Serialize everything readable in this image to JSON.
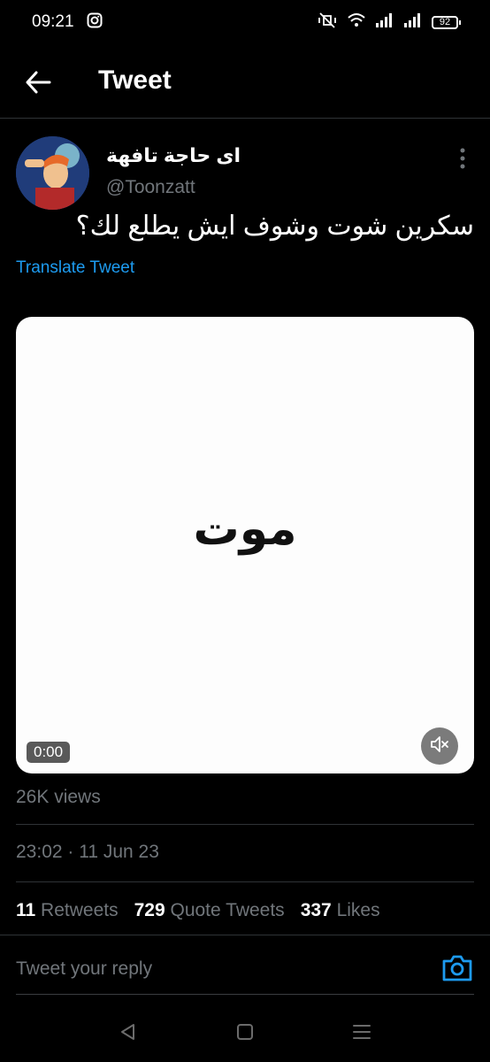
{
  "status_bar": {
    "time": "09:21",
    "battery": "92",
    "icons": [
      "instagram-icon",
      "mute-vibrate-icon",
      "wifi-icon",
      "signal-icon",
      "signal-icon",
      "battery-icon"
    ]
  },
  "header": {
    "title": "Tweet",
    "back_icon": "arrow-left-icon"
  },
  "tweet": {
    "author_name": "اى حاجة تافهة",
    "author_handle": "@Toonzatt",
    "text": "سكرين شوت وشوف ايش يطلع لك؟",
    "translate_label": "Translate Tweet",
    "media": {
      "word": "موت",
      "time": "0:00",
      "mute_icon": "speaker-muted-icon"
    },
    "views": "26K views",
    "timestamp": "23:02 · 11 Jun 23",
    "stats": [
      {
        "count": "11",
        "label": "Retweets"
      },
      {
        "count": "729",
        "label": "Quote Tweets"
      },
      {
        "count": "337",
        "label": "Likes"
      }
    ]
  },
  "reply": {
    "placeholder": "Tweet your reply",
    "camera_icon": "camera-icon"
  },
  "nav_bar": {
    "icons": [
      "back-triangle-icon",
      "home-square-icon",
      "recents-menu-icon"
    ]
  },
  "colors": {
    "background": "#000000",
    "accent": "#1d9bf0",
    "secondary_text": "#71767b"
  }
}
